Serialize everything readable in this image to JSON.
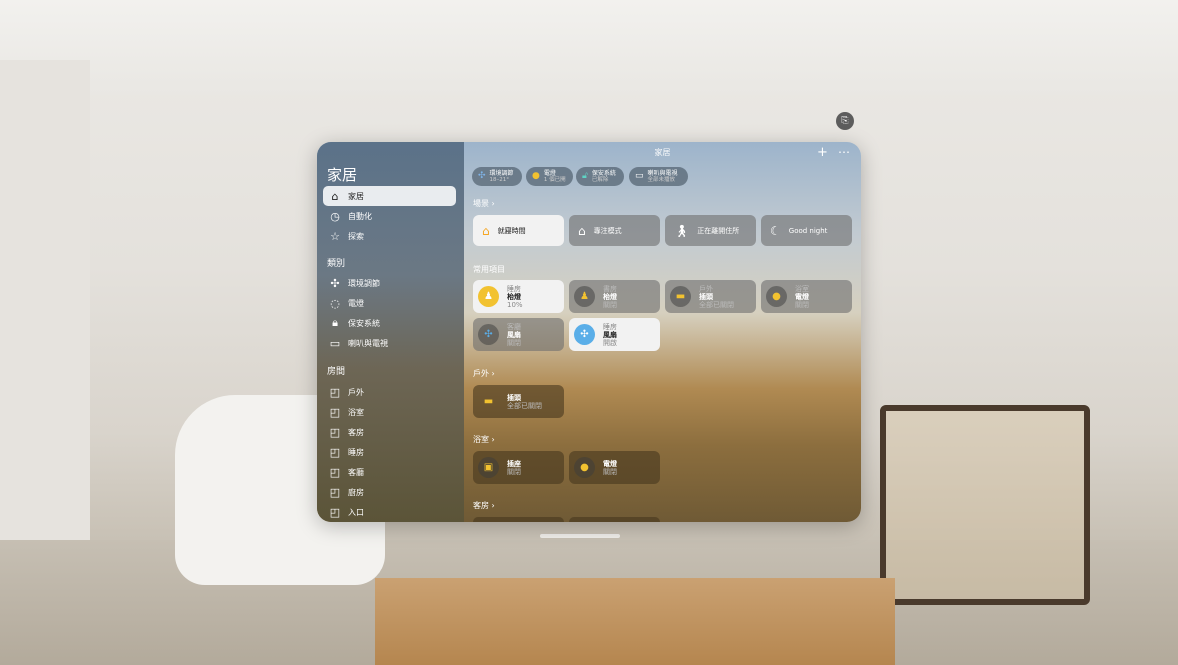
{
  "sidebar": {
    "title": "家居",
    "items": [
      {
        "label": "家居",
        "icon": "house-icon"
      },
      {
        "label": "自動化",
        "icon": "clock-icon"
      },
      {
        "label": "探索",
        "icon": "star-icon"
      }
    ],
    "categories_header": "類別",
    "categories": [
      {
        "label": "環境調節",
        "icon": "fan-icon"
      },
      {
        "label": "電燈",
        "icon": "lightbulb-icon"
      },
      {
        "label": "保安系統",
        "icon": "lock-icon"
      },
      {
        "label": "喇叭與電視",
        "icon": "tv-speaker-icon"
      }
    ],
    "rooms_header": "房間",
    "rooms": [
      "戶外",
      "浴室",
      "客房",
      "睡房",
      "客廳",
      "廚房",
      "入口"
    ]
  },
  "main": {
    "title": "家居",
    "status": [
      {
        "label": "環境調節",
        "value": "18–21°"
      },
      {
        "label": "電燈",
        "value": "1 個已開"
      },
      {
        "label": "保安系統",
        "value": "已解除"
      },
      {
        "label": "喇叭與電視",
        "value": "全部未播放"
      }
    ],
    "scenes_header": "場景",
    "scenes": [
      "就寢時間",
      "專注模式",
      "正在離開住所",
      "Good night"
    ],
    "favorites_header": "常用項目",
    "favorites": [
      {
        "room": "睡房",
        "name": "枱燈",
        "state": "10%"
      },
      {
        "room": "書房",
        "name": "枱燈",
        "state": "關閉"
      },
      {
        "room": "戶外",
        "name": "插頭",
        "state": "全部已關閉"
      },
      {
        "room": "浴室",
        "name": "電燈",
        "state": "關閉"
      },
      {
        "room": "客廳",
        "name": "風扇",
        "state": "關閉"
      },
      {
        "room": "睡房",
        "name": "風扇",
        "state": "開啟"
      }
    ],
    "outdoor_header": "戶外",
    "outdoor": [
      {
        "name": "插頭",
        "state": "全部已關閉"
      }
    ],
    "bathroom_header": "浴室",
    "bathroom": [
      {
        "name": "插座",
        "state": "關閉"
      },
      {
        "name": "電燈",
        "state": "關閉"
      }
    ],
    "guest_header": "客房"
  },
  "colors": {
    "accent": "#f5a623",
    "light_on": "#f2c230",
    "fan_on": "#5aaee8"
  }
}
